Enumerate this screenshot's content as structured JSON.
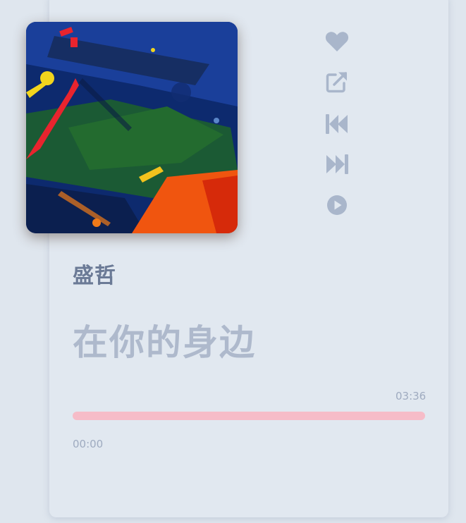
{
  "player": {
    "artist": "盛哲",
    "title": "在你的身边",
    "current_time": "00:00",
    "total_time": "03:36",
    "progress": 0.0
  },
  "controls": [
    {
      "name": "heart-icon"
    },
    {
      "name": "share-icon"
    },
    {
      "name": "previous-icon"
    },
    {
      "name": "next-icon"
    },
    {
      "name": "play-icon"
    }
  ],
  "colors": {
    "icon": "#a9b6cb",
    "progress_track": "#f6bcc8",
    "progress_fill": "#f08aa0",
    "artist": "#6b7a96",
    "title": "#aeb9cc"
  }
}
